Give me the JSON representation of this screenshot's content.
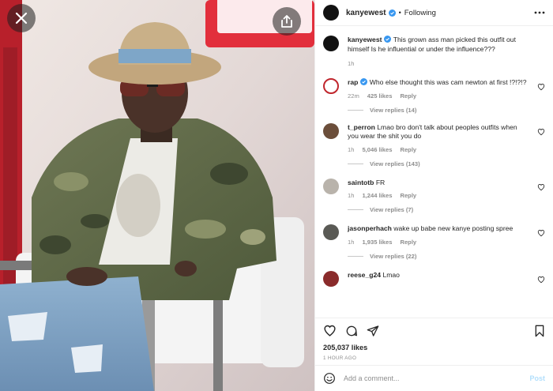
{
  "header": {
    "username": "kanyewest",
    "separator": "•",
    "follow_status": "Following"
  },
  "caption": {
    "username": "kanyewest",
    "text": "This grown ass man picked this outfit out himself Is he influential or under the influence???",
    "time": "1h"
  },
  "comments": [
    {
      "username": "rap",
      "verified": true,
      "text": "Who else thought this was cam newton at first !?!?!?",
      "time": "22m",
      "likes": "425 likes",
      "reply": "Reply",
      "view_replies": "View replies (14)"
    },
    {
      "username": "t_perron",
      "verified": false,
      "text": "Lmao bro don't talk about peoples outfits when you wear the shit you do",
      "time": "1h",
      "likes": "5,046 likes",
      "reply": "Reply",
      "view_replies": "View replies (143)"
    },
    {
      "username": "saintotb",
      "verified": false,
      "text": "FR",
      "time": "1h",
      "likes": "1,244 likes",
      "reply": "Reply",
      "view_replies": "View replies (7)"
    },
    {
      "username": "jasonperhach",
      "verified": false,
      "text": "wake up babe new kanye posting spree",
      "time": "1h",
      "likes": "1,935 likes",
      "reply": "Reply",
      "view_replies": "View replies (22)"
    },
    {
      "username": "reese_g24",
      "verified": false,
      "text": "Lmao",
      "time": "",
      "likes": "",
      "reply": "",
      "view_replies": ""
    }
  ],
  "post": {
    "likes_total": "205,037 likes",
    "timestamp": "1 HOUR AGO"
  },
  "add_comment": {
    "placeholder": "Add a comment...",
    "post_label": "Post"
  },
  "icons": {
    "close": "close-icon",
    "share": "share-icon",
    "more": "more-icon",
    "verified": "verified-badge-icon",
    "heart": "heart-icon",
    "comment": "comment-icon",
    "send": "send-icon",
    "bookmark": "bookmark-icon",
    "emoji": "emoji-icon"
  },
  "colors": {
    "verified_blue": "#3897f0",
    "muted_text": "#8e8e8e",
    "post_button_disabled": "#b2dffc"
  }
}
